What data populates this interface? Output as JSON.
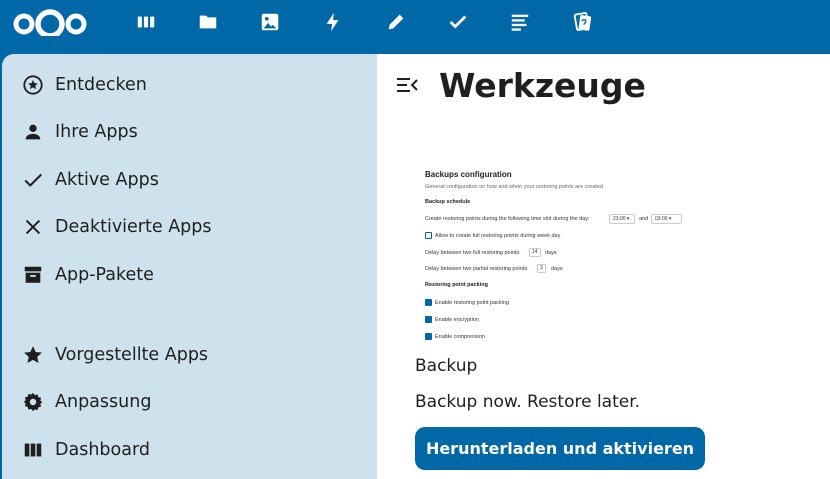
{
  "header": {
    "icons": [
      "nextcloud-logo",
      "dashboard-icon",
      "files-icon",
      "photos-icon",
      "activity-icon",
      "notes-icon",
      "tasks-icon",
      "deck-icon",
      "news-icon"
    ]
  },
  "sidebar": {
    "items": [
      {
        "label": "Entdecken",
        "icon": "star-circle-icon"
      },
      {
        "label": "Ihre Apps",
        "icon": "account-icon"
      },
      {
        "label": "Aktive Apps",
        "icon": "check-icon"
      },
      {
        "label": "Deaktivierte Apps",
        "icon": "close-icon"
      },
      {
        "label": "App-Pakete",
        "icon": "archive-icon"
      },
      {
        "label": "Vorgestellte Apps",
        "icon": "star-icon"
      },
      {
        "label": "Anpassung",
        "icon": "cog-icon"
      },
      {
        "label": "Dashboard",
        "icon": "view-column-icon"
      }
    ]
  },
  "main": {
    "title": "Werkzeuge",
    "preview": {
      "title": "Backups configuration",
      "subtitle": "General configuration on how and when your restoring points are created.",
      "schedule_heading": "Backup schedule",
      "schedule_text": "Create restoring points during the following time slot during the day:",
      "time_from": "23:00",
      "and": "and",
      "time_to": "03:00",
      "allow_week_day": "Allow to create full restoring points during week day",
      "delay_full_label": "Delay between two full restoring points:",
      "delay_full_value": "14",
      "delay_full_unit": "days",
      "delay_partial_label": "Delay between two partial restoring points:",
      "delay_partial_value": "3",
      "delay_partial_unit": "days",
      "packing_heading": "Restoring point packing",
      "enable_packing": "Enable restoring point packing",
      "enable_encryption": "Enable encryption",
      "enable_compression": "Enable compression"
    },
    "app_name": "Backup",
    "app_description": "Backup now. Restore later.",
    "download_button": "Herunterladen und aktivieren"
  },
  "colors": {
    "primary": "#0068a6",
    "sidebar_bg": "#cde2ed",
    "text": "#1f1f1f"
  }
}
